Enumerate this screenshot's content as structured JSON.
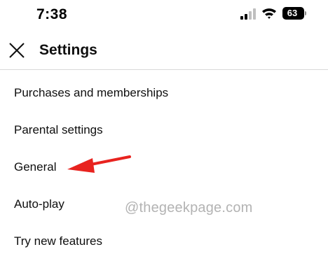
{
  "status_bar": {
    "time": "7:38",
    "battery_level": "63",
    "icons": [
      "cellular-signal-icon",
      "wifi-icon",
      "battery-icon"
    ]
  },
  "header": {
    "title": "Settings",
    "close_icon": "close-icon"
  },
  "menu": {
    "items": [
      {
        "label": "Purchases and memberships"
      },
      {
        "label": "Parental settings"
      },
      {
        "label": "General"
      },
      {
        "label": "Auto-play"
      },
      {
        "label": "Try new features"
      }
    ]
  },
  "annotation": {
    "arrow_color": "#e8231f",
    "points_to": "General"
  },
  "watermark": "@thegeekpage.com",
  "colors": {
    "background": "#ffffff",
    "text": "#0f0f0f",
    "divider": "#d9d9d9"
  }
}
